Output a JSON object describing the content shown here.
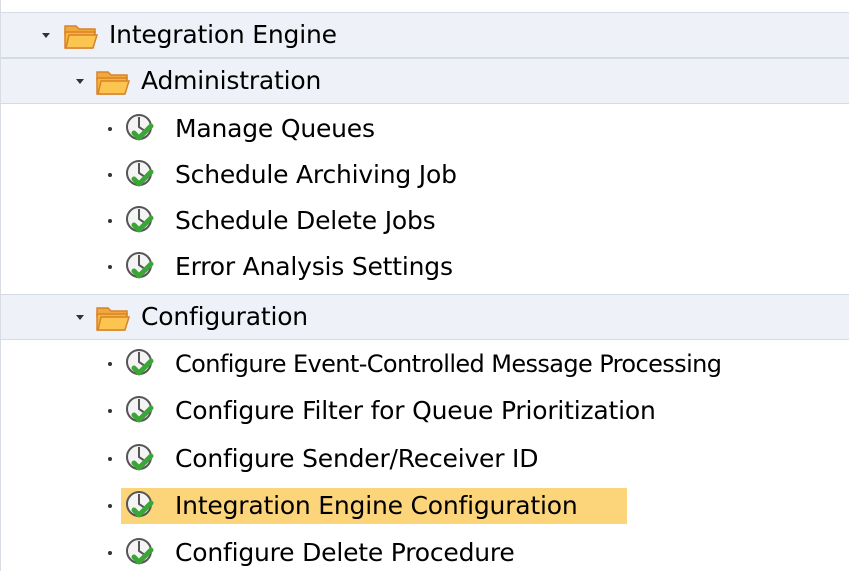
{
  "tree": {
    "root": {
      "label": "Integration Engine",
      "icon": "folder-open-icon",
      "expanded": true
    },
    "groups": [
      {
        "label": "Administration",
        "icon": "folder-open-icon",
        "expanded": true,
        "items": [
          {
            "label": "Manage Queues",
            "icon": "transaction-execute-icon"
          },
          {
            "label": "Schedule Archiving Job",
            "icon": "transaction-execute-icon"
          },
          {
            "label": "Schedule Delete Jobs",
            "icon": "transaction-execute-icon"
          },
          {
            "label": "Error Analysis Settings",
            "icon": "transaction-execute-icon"
          }
        ]
      },
      {
        "label": "Configuration",
        "icon": "folder-open-icon",
        "expanded": true,
        "items": [
          {
            "label": "Configure Event-Controlled Message Processing",
            "icon": "transaction-execute-icon"
          },
          {
            "label": "Configure Filter for Queue Prioritization",
            "icon": "transaction-execute-icon"
          },
          {
            "label": "Configure Sender/Receiver ID",
            "icon": "transaction-execute-icon"
          },
          {
            "label": "Integration Engine Configuration",
            "icon": "transaction-execute-icon",
            "selected": true
          },
          {
            "label": "Configure Delete Procedure",
            "icon": "transaction-execute-icon"
          }
        ]
      }
    ]
  },
  "colors": {
    "folder_row_bg": "#eef2f8",
    "selected_bg": "#fcd57a",
    "folder_fill": "#f7b733",
    "folder_stroke": "#d9822b",
    "check_green": "#3aa635"
  }
}
